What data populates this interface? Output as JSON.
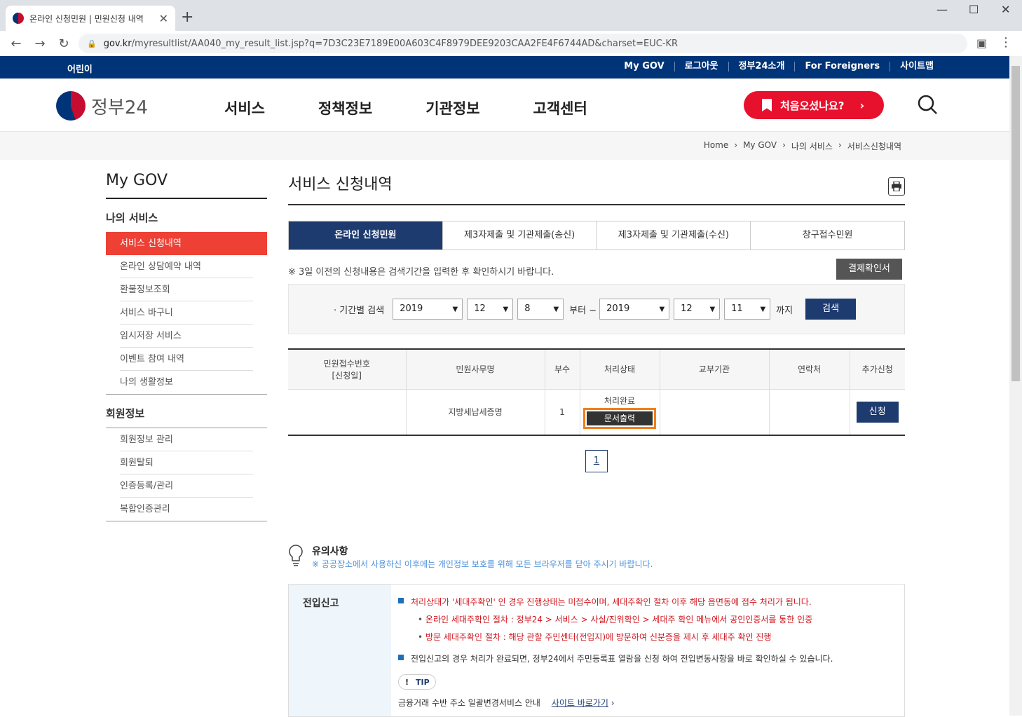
{
  "browser": {
    "tab_title": "온라인 신청민원 | 민원신청 내역",
    "url_host": "gov.kr",
    "url_path": "/myresultlist/AA040_my_result_list.jsp?q=7D3C23E7189E00A603C4F8979DEE9203CAA2FE4F6744AD&charset=EUC-KR"
  },
  "util": {
    "child": "어린이",
    "links": [
      "My GOV",
      "로그아웃",
      "정부24소개",
      "For Foreigners",
      "사이트맵"
    ]
  },
  "header": {
    "logo": "정부24",
    "nav": [
      "서비스",
      "정책정보",
      "기관정보",
      "고객센터"
    ],
    "first_visit": "처음오셨나요?"
  },
  "breadcrumb": [
    "Home",
    "My GOV",
    "나의 서비스",
    "서비스신청내역"
  ],
  "lnb": {
    "title": "My GOV",
    "section1": "나의 서비스",
    "items1": [
      "서비스 신청내역",
      "온라인 상담예약 내역",
      "환불정보조회",
      "서비스 바구니",
      "임시저장 서비스",
      "이벤트 참여 내역",
      "나의 생활정보"
    ],
    "section2": "회원정보",
    "items2": [
      "회원정보 관리",
      "회원탈퇴",
      "인증등록/관리",
      "복합인증관리"
    ]
  },
  "content": {
    "title": "서비스 신청내역",
    "tabs": [
      "온라인 신청민원",
      "제3자제출 및 기관제출(송신)",
      "제3자제출 및 기관제출(수신)",
      "창구접수민원"
    ],
    "notice": "※ 3일 이전의 신청내용은 검색기간을 입력한 후 확인하시기 바랍니다.",
    "pay_confirm": "결제확인서",
    "filter": {
      "label": "· 기간별 검색",
      "from_year": "2019",
      "from_month": "12",
      "from_day": "8",
      "from_text": "부터 ~",
      "to_year": "2019",
      "to_month": "12",
      "to_day": "11",
      "to_text": "까지",
      "search": "검색"
    },
    "table": {
      "headers": [
        "민원접수번호",
        "[신청일]",
        "민원사무명",
        "부수",
        "처리상태",
        "교부기관",
        "연락처",
        "추가신청"
      ],
      "row": {
        "receipt_no": "",
        "name": "지방세납세증명",
        "count": "1",
        "status": "처리완료",
        "print": "문서출력",
        "agency": "",
        "contact": "",
        "apply": "신청"
      }
    },
    "page": "1"
  },
  "caution": {
    "title": "유의사항",
    "desc": "※ 공공장소에서 사용하신 이후에는 개인정보 보호를 위해 모든 브라우저를 닫아 주시기 바랍니다."
  },
  "infobox": {
    "side": "전입신고",
    "line1": "처리상태가 '세대주확인' 인 경우 진행상태는 미접수이며, 세대주확인 절차 이후 해당 읍면동에 접수 처리가 됩니다.",
    "sub1": "온라인 세대주확인 절차 : 정부24 > 서비스 > 사실/진위확인 > 세대주 확인 메뉴에서 공인인증서를 통한 인증",
    "sub2": "방문 세대주확인 절차 : 해당 관할 주민센터(전입지)에 방문하여 신분증을 제시 후 세대주 확인 진행",
    "line2": "전입신고의 경우 처리가 완료되면, 정부24에서 주민등록표 열람을 신청 하여 전입변동사항을 바로 확인하실 수 있습니다.",
    "tip": "TIP",
    "finance": "금융거래 수반 주소 일괄변경서비스 안내",
    "finance_link": "사이트 바로가기"
  }
}
